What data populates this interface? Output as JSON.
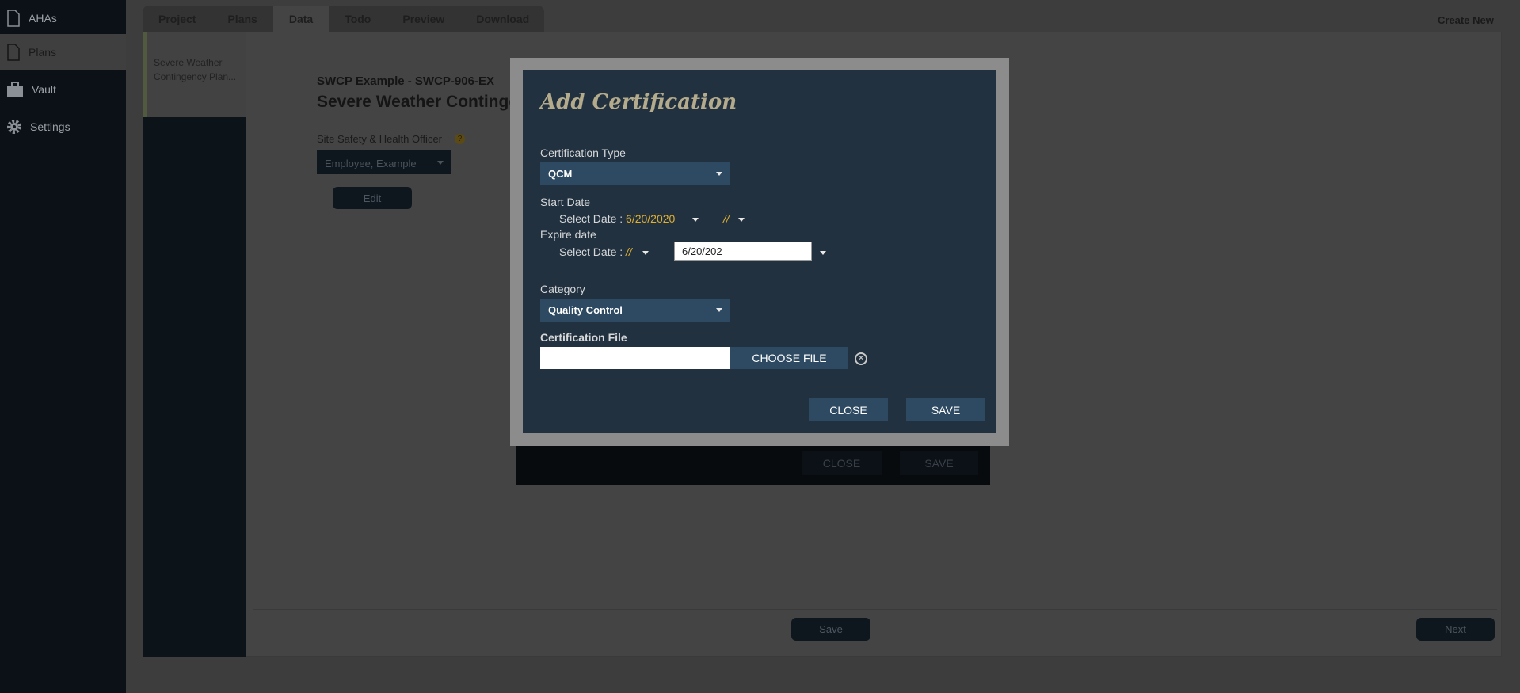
{
  "sidebar": {
    "items": [
      {
        "label": "AHAs",
        "icon": "document-icon"
      },
      {
        "label": "Plans",
        "icon": "document-icon",
        "active": true
      },
      {
        "label": "Vault",
        "icon": "briefcase-icon"
      },
      {
        "label": "Settings",
        "icon": "gear-icon"
      }
    ]
  },
  "tabs": [
    {
      "label": "Project"
    },
    {
      "label": "Plans"
    },
    {
      "label": "Data",
      "active": true
    },
    {
      "label": "Todo"
    },
    {
      "label": "Preview"
    },
    {
      "label": "Download"
    }
  ],
  "create_new": "Create New",
  "list": {
    "item": "Severe Weather Contingency Plan..."
  },
  "content": {
    "subtitle": "SWCP Example - SWCP-906-EX",
    "title": "Severe Weather Contingen",
    "officer_label": "Site Safety & Health Officer",
    "officer_value": "Employee, Example",
    "edit": "Edit"
  },
  "footer": {
    "save": "Save",
    "next": "Next"
  },
  "background_modal": {
    "close": "CLOSE",
    "save": "SAVE"
  },
  "modal": {
    "title": "Add Certification",
    "cert_type_label": "Certification Type",
    "cert_type_value": "QCM",
    "start_label": "Start Date",
    "start_select_label": "Select Date :",
    "start_value": "6/20/2020",
    "start_time": "//",
    "expire_label": "Expire date",
    "expire_select_label": "Select Date :",
    "expire_value": "//",
    "expire_input": "6/20/202",
    "category_label": "Category",
    "category_value": "Quality Control",
    "file_label": "Certification File",
    "choose_file": "CHOOSE FILE",
    "close": "CLOSE",
    "save": "SAVE"
  },
  "colors": {
    "modal_bg": "#22313f",
    "control_bg": "#2d4a62",
    "date_accent": "#e0b030"
  }
}
